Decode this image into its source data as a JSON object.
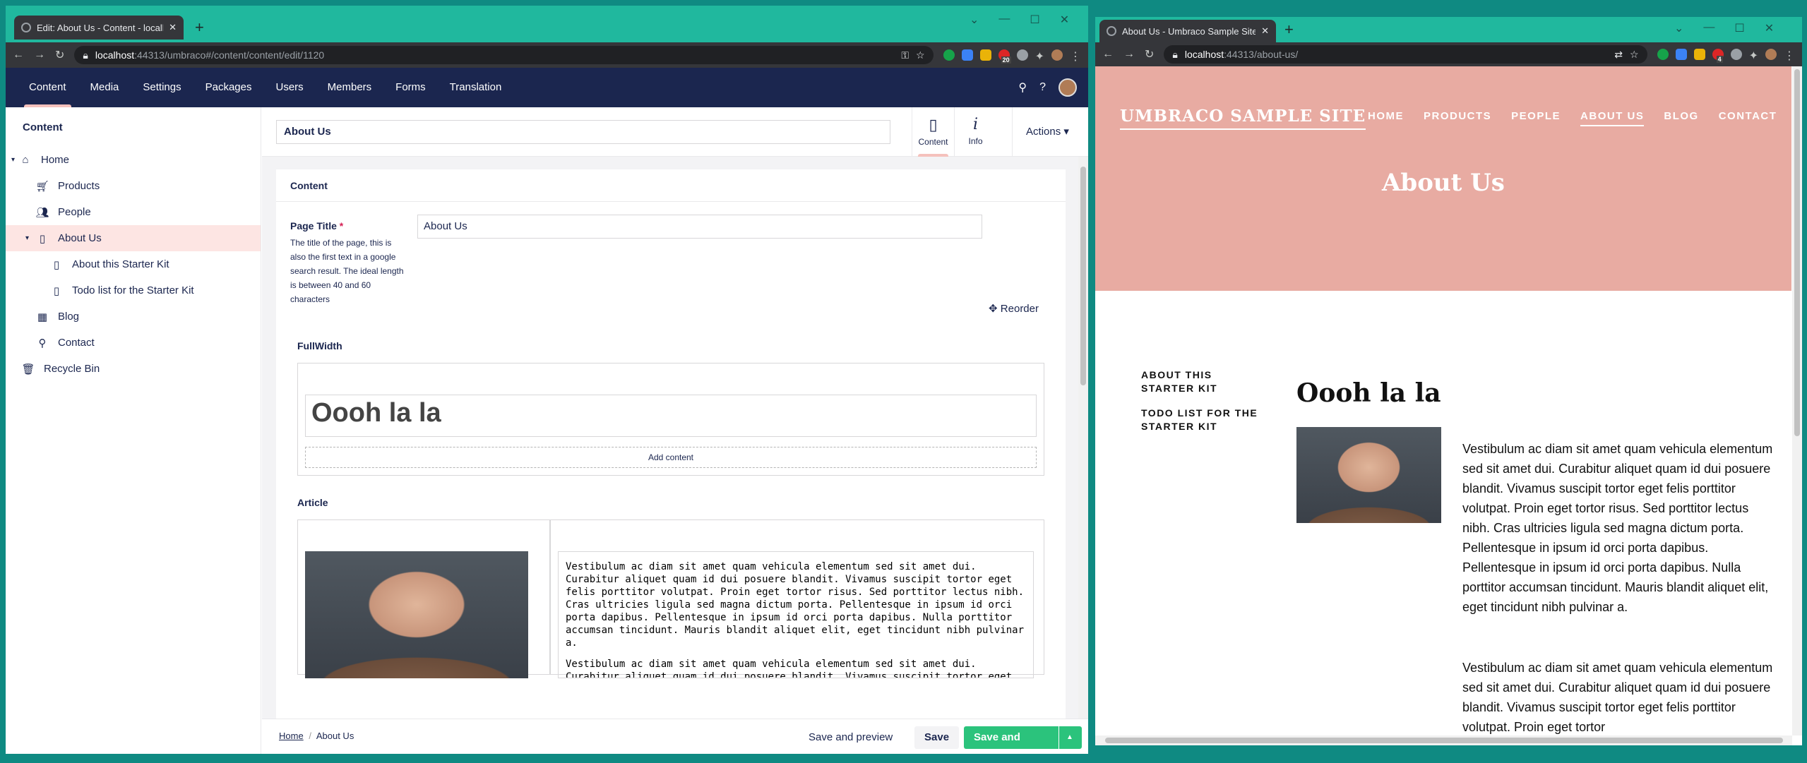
{
  "left": {
    "tab_title": "Edit: About Us - Content - localh",
    "url_host": "localhost",
    "url_path": ":44313/umbraco#/content/content/edit/1120",
    "nav": [
      "Content",
      "Media",
      "Settings",
      "Packages",
      "Users",
      "Members",
      "Forms",
      "Translation"
    ],
    "tree": {
      "heading": "Content",
      "items": [
        "Home",
        "Products",
        "People",
        "About Us",
        "About this Starter Kit",
        "Todo list for the Starter Kit",
        "Blog",
        "Contact",
        "Recycle Bin"
      ]
    },
    "node_name": "About Us",
    "apps": {
      "content": "Content",
      "info": "Info",
      "actions": "Actions"
    },
    "group": "Content",
    "page_title_label": "Page Title",
    "required_mark": "*",
    "page_title_desc": "The title of the page, this is also the first text in a google search result. The ideal length is between 40 and 60 characters",
    "page_title_value": "About Us",
    "reorder": "Reorder",
    "fullwidth": "FullWidth",
    "heading_value": "Oooh la la",
    "add_content": "Add content",
    "article": "Article",
    "rte_p1": "Vestibulum ac diam sit amet quam vehicula elementum sed sit amet dui. Curabitur aliquet quam id dui posuere blandit. Vivamus suscipit tortor eget felis porttitor volutpat. Proin eget tortor risus. Sed porttitor lectus nibh. Cras ultricies ligula sed magna dictum porta. Pellentesque in ipsum id orci porta dapibus. Pellentesque in ipsum id orci porta dapibus. Nulla porttitor accumsan tincidunt. Mauris blandit aliquet elit, eget tincidunt nibh pulvinar a.",
    "rte_p2": "Vestibulum ac diam sit amet quam vehicula elementum sed sit amet dui. Curabitur aliquet quam id dui posuere blandit. Vivamus suscipit tortor eget felis porttitor volutpat. Proin eget",
    "breadcrumb": {
      "home": "Home",
      "sep": "/",
      "current": "About Us"
    },
    "buttons": {
      "preview": "Save and preview",
      "save": "Save",
      "publish": "Save and publish"
    },
    "badge": "20"
  },
  "right": {
    "tab_title": "About Us - Umbraco Sample Site",
    "url_host": "localhost",
    "url_path": ":44313/about-us/",
    "brand": "UMBRACO SAMPLE SITE",
    "nav": [
      "HOME",
      "PRODUCTS",
      "PEOPLE",
      "ABOUT US",
      "BLOG",
      "CONTACT"
    ],
    "hero_title": "About Us",
    "side": [
      "ABOUT THIS STARTER KIT",
      "TODO LIST FOR THE STARTER KIT"
    ],
    "heading": "Oooh la la",
    "p1": "Vestibulum ac diam sit amet quam vehicula elementum sed sit amet dui. Curabitur aliquet quam id dui posuere blandit. Vivamus suscipit tortor eget felis porttitor volutpat. Proin eget tortor risus. Sed porttitor lectus nibh. Cras ultricies ligula sed magna dictum porta. Pellentesque in ipsum id orci porta dapibus. Pellentesque in ipsum id orci porta dapibus. Nulla porttitor accumsan tincidunt. Mauris blandit aliquet elit, eget tincidunt nibh pulvinar a.",
    "p2": "Vestibulum ac diam sit amet quam vehicula elementum sed sit amet dui. Curabitur aliquet quam id dui posuere blandit. Vivamus suscipit tortor eget felis porttitor volutpat. Proin eget tortor",
    "badge": "4"
  },
  "colors": {
    "umbraco_nav": "#1b264f",
    "publish": "#2bc37c",
    "hero": "#e8aba2",
    "titlebar": "#20b89e"
  }
}
